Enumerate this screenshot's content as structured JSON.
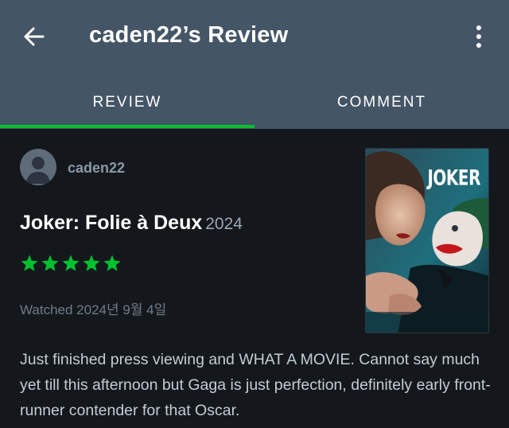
{
  "header": {
    "title": "caden22’s Review",
    "back_icon": "arrow-left-icon",
    "more_icon": "more-vertical-icon",
    "background": "#445566"
  },
  "tabs": [
    {
      "label": "REVIEW",
      "active": true
    },
    {
      "label": "COMMENT",
      "active": false
    }
  ],
  "accent_color": "#00c030",
  "review": {
    "username": "caden22",
    "film_title": "Joker: Folie à Deux",
    "film_year": "2024",
    "rating": 5,
    "rating_max": 5,
    "watched": "Watched 2024년 9월 4일",
    "text": "Just finished press viewing and WHAT A MOVIE. Cannot say much yet till this afternoon but Gaga is just perfection, definitely early front-runner contender for that Oscar."
  },
  "poster": {
    "title": "JOKER"
  }
}
